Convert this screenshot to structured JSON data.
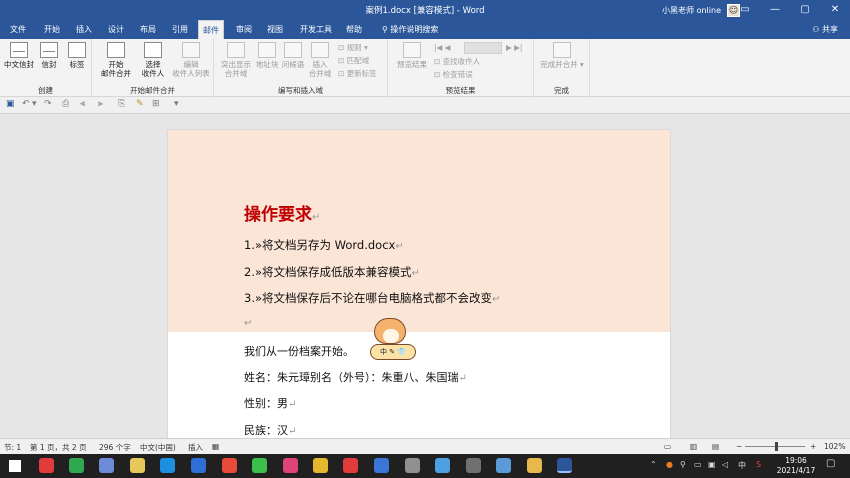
{
  "window": {
    "title": "案例1.docx [兼容模式]  -  Word",
    "user": "小黑老师 online",
    "controls": [
      "▭",
      "—",
      "▢",
      "✕"
    ]
  },
  "tabs": [
    "文件",
    "开始",
    "插入",
    "设计",
    "布局",
    "引用",
    "邮件",
    "审阅",
    "视图",
    "开发工具",
    "帮助",
    "操作说明搜索"
  ],
  "share": "共享",
  "ribbon": {
    "groups": {
      "create": "创建",
      "start_merge": "开始邮件合并",
      "write_insert": "编写和插入域",
      "preview": "预览结果",
      "finish": "完成"
    },
    "buttons": {
      "cn_envelope": "中文信封",
      "envelope": "信封",
      "labels": "标签",
      "start_merge_1": "开始",
      "start_merge_2": "邮件合并",
      "select_1": "选择",
      "select_2": "收件人",
      "edit_1": "编辑",
      "edit_2": "收件人列表",
      "highlight_1": "突出显示",
      "highlight_2": "合并域",
      "address_block": "地址块",
      "greeting": "问候语",
      "insert_1": "插入",
      "insert_2": "合并域",
      "rules": "规则",
      "match_fields": "匹配域",
      "update_labels": "更新标签",
      "preview_results": "预览结果",
      "find_recipient": "查找收件人",
      "check_errors": "检查错误",
      "finish_1": "完成并合并"
    }
  },
  "document": {
    "heading": "操作要求",
    "items": [
      "1.»将文档另存为 Word.docx",
      "2.»将文档保存成低版本兼容模式",
      "3.»将文档保存后不论在哪台电脑格式都不会改变"
    ],
    "body": [
      "我们从一份档案开始。",
      "姓名：朱元璋别名（外号）：朱重八、朱国瑞",
      "性别：男",
      "民族：汉"
    ],
    "para_mark": "↵",
    "sticker_text": "中 ✎ 👕"
  },
  "statusbar": {
    "section": "节: 1",
    "page": "第 1 页，共 2 页",
    "words": "296 个字",
    "language": "中文(中国)",
    "insert_mode": "插入",
    "zoom_minus": "−",
    "zoom_plus": "+",
    "zoom": "102%"
  },
  "taskbar": {
    "time": "19:06",
    "date": "2021/4/17",
    "ime": "中",
    "icons": [
      {
        "name": "start-icon",
        "color": "#ffffff"
      },
      {
        "name": "xmind-icon",
        "color": "#e03a3a"
      },
      {
        "name": "green-app-icon",
        "color": "#2fa84f"
      },
      {
        "name": "screen-icon",
        "color": "#6c8bd8"
      },
      {
        "name": "notes-icon",
        "color": "#e8c85a"
      },
      {
        "name": "edge-icon",
        "color": "#1c8fe0"
      },
      {
        "name": "star-icon",
        "color": "#2d6fd6"
      },
      {
        "name": "chrome-icon",
        "color": "#e84b3a"
      },
      {
        "name": "wechat-icon",
        "color": "#3cc04c"
      },
      {
        "name": "red-app-icon",
        "color": "#e0427a"
      },
      {
        "name": "colorful-icon",
        "color": "#e5b62e"
      },
      {
        "name": "netease-icon",
        "color": "#e03a3a"
      },
      {
        "name": "word-blue-icon",
        "color": "#3a76d8"
      },
      {
        "name": "cloud-icon",
        "color": "#909090"
      },
      {
        "name": "photos-icon",
        "color": "#4aa0e0"
      },
      {
        "name": "circle-app-icon",
        "color": "#707070"
      },
      {
        "name": "glasses-icon",
        "color": "#5a9ad8"
      },
      {
        "name": "folder-icon",
        "color": "#e8b84a"
      },
      {
        "name": "word-icon",
        "color": "#2b579a"
      }
    ]
  }
}
